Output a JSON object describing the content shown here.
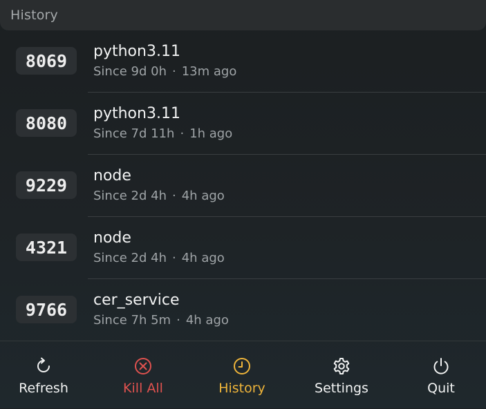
{
  "header": {
    "title": "History"
  },
  "rows": [
    {
      "port": "8069",
      "name": "python3.11",
      "since": "Since 9d 0h",
      "sep": "·",
      "ago": "13m ago"
    },
    {
      "port": "8080",
      "name": "python3.11",
      "since": "Since 7d 11h",
      "sep": "·",
      "ago": "1h ago"
    },
    {
      "port": "9229",
      "name": "node",
      "since": "Since 2d 4h",
      "sep": "·",
      "ago": "4h ago"
    },
    {
      "port": "4321",
      "name": "node",
      "since": "Since 2d 4h",
      "sep": "·",
      "ago": "4h ago"
    },
    {
      "port": "9766",
      "name": "cer_service",
      "since": "Since 7h 5m",
      "sep": "·",
      "ago": "4h ago"
    }
  ],
  "toolbar": {
    "refresh": {
      "label": "Refresh",
      "icon": "refresh-icon",
      "color": "#f2f3f3"
    },
    "kill_all": {
      "label": "Kill All",
      "icon": "kill-all-icon",
      "color": "#e0524f"
    },
    "history": {
      "label": "History",
      "icon": "clock-icon",
      "color": "#f0b53a"
    },
    "settings": {
      "label": "Settings",
      "icon": "gear-icon",
      "color": "#f2f3f3"
    },
    "quit": {
      "label": "Quit",
      "icon": "power-icon",
      "color": "#f2f3f3"
    }
  }
}
